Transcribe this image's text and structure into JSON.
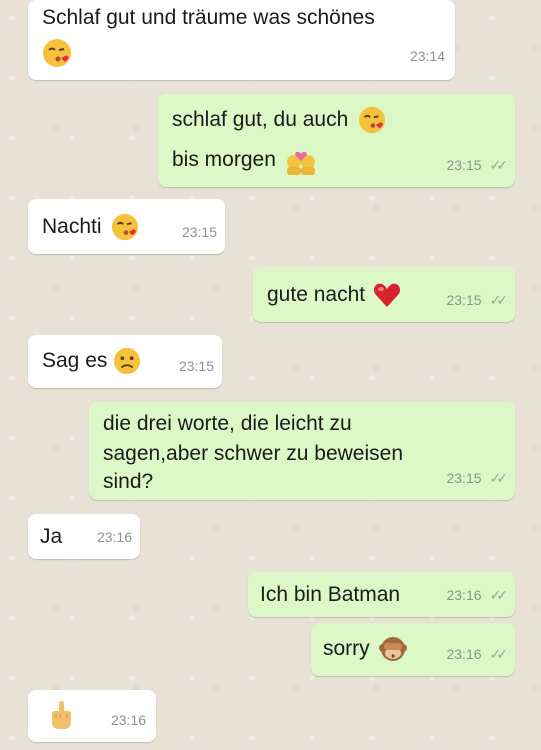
{
  "messages": [
    {
      "side": "in",
      "lines": [
        "Schlaf gut und träume was schönes"
      ],
      "time": "23:14"
    },
    {
      "side": "out",
      "lines": [
        "schlaf gut, du auch",
        "bis morgen"
      ],
      "time": "23:15"
    },
    {
      "side": "in",
      "lines": [
        "Nachti"
      ],
      "time": "23:15"
    },
    {
      "side": "out",
      "lines": [
        "gute nacht"
      ],
      "time": "23:15"
    },
    {
      "side": "in",
      "lines": [
        "Sag es"
      ],
      "time": "23:15"
    },
    {
      "side": "out",
      "lines": [
        "die drei worte, die leicht zu",
        "sagen,aber schwer zu beweisen",
        "sind?"
      ],
      "time": "23:15"
    },
    {
      "side": "in",
      "lines": [
        "Ja"
      ],
      "time": "23:16"
    },
    {
      "side": "out",
      "lines": [
        "Ich bin Batman"
      ],
      "time": "23:16"
    },
    {
      "side": "out",
      "lines": [
        "sorry"
      ],
      "time": "23:16"
    },
    {
      "side": "in",
      "lines": [
        ""
      ],
      "time": "23:16"
    }
  ],
  "read_receipt_icon": "double-check-icon",
  "emoji_names": {
    "kiss": "face-throwing-kiss-icon",
    "couple": "couple-with-heart-icon",
    "heart": "red-heart-icon",
    "confused": "confused-face-icon",
    "monkey": "see-no-evil-monkey-icon",
    "finger": "middle-finger-icon"
  },
  "colors": {
    "incoming_bubble": "#ffffff",
    "outgoing_bubble": "#dcf8c6",
    "timestamp": "#8a948c",
    "background": "#e8e2d6"
  }
}
